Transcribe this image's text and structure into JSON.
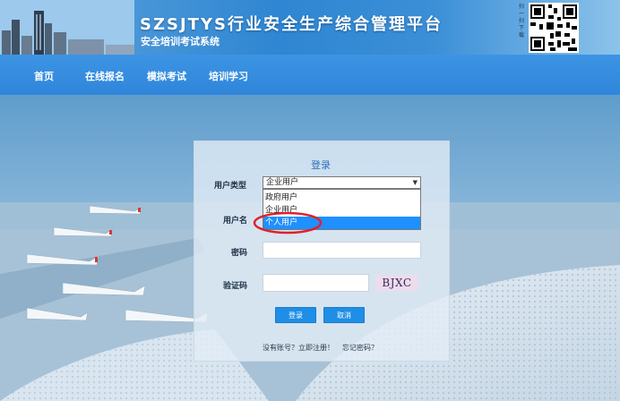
{
  "header": {
    "title": "SZSJTYS行业安全生产综合管理平台",
    "subtitle": "安全培训考试系统",
    "qr_label": "扫一扫下载"
  },
  "nav": {
    "items": [
      {
        "label": "首页"
      },
      {
        "label": "在线报名"
      },
      {
        "label": "模拟考试"
      },
      {
        "label": "培训学习"
      }
    ]
  },
  "login": {
    "title": "登录",
    "user_type_label": "用户类型",
    "user_type_value": "企业用户",
    "user_type_options": [
      "政府用户",
      "企业用户",
      "个人用户"
    ],
    "highlighted_option": "个人用户",
    "username_label": "用户名",
    "password_label": "密码",
    "captcha_label": "验证码",
    "captcha_code": "BJXC",
    "login_button": "登录",
    "cancel_button": "取消",
    "register_link": "没有账号？立即注册！",
    "forgot_link": "忘记密码？"
  },
  "colors": {
    "nav_bg": "#3a91e2",
    "button_bg": "#1e8ee6",
    "option_highlight": "#1e90ff",
    "annotation": "#e0202a"
  }
}
